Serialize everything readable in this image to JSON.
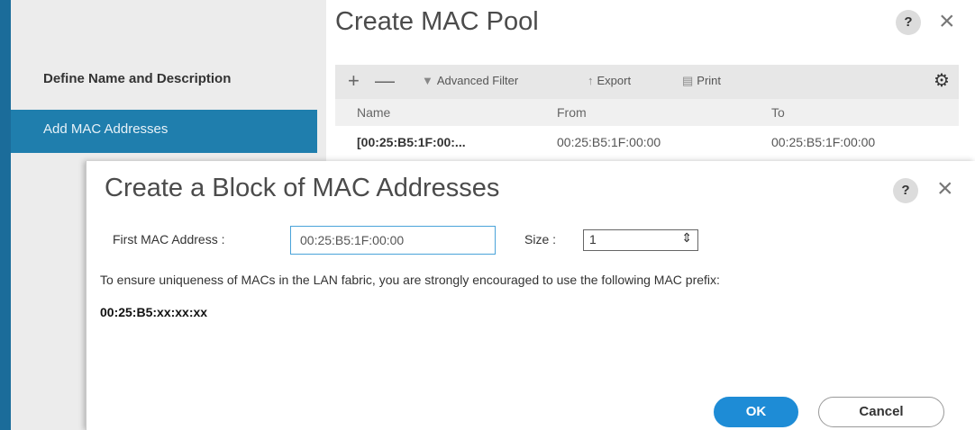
{
  "wizard": {
    "steps": [
      {
        "label": "Define Name and Description"
      },
      {
        "label": "Add MAC Addresses"
      }
    ]
  },
  "outer_dialog": {
    "title": "Create MAC Pool",
    "help_label": "?",
    "close_label": "×",
    "toolbar": {
      "add_label": "+",
      "remove_label": "—",
      "filter_label": "Advanced Filter",
      "export_label": "Export",
      "print_label": "Print",
      "settings_icon": "gear-icon"
    },
    "table": {
      "columns": [
        "Name",
        "From",
        "To"
      ],
      "rows": [
        {
          "name": "[00:25:B5:1F:00:...",
          "from": "00:25:B5:1F:00:00",
          "to": "00:25:B5:1F:00:00"
        }
      ]
    }
  },
  "modal": {
    "title": "Create a Block of MAC Addresses",
    "help_label": "?",
    "close_label": "×",
    "first_mac_label": "First MAC Address :",
    "first_mac_value": "00:25:B5:1F:00:00",
    "size_label": "Size :",
    "size_value": "1",
    "info_text": "To ensure uniqueness of MACs in the LAN fabric, you are strongly encouraged to use the following MAC prefix:",
    "prefix_text": "00:25:B5:xx:xx:xx",
    "ok_label": "OK",
    "cancel_label": "Cancel"
  },
  "colors": {
    "accent": "#1f7ead",
    "primary_button": "#1e8cd6",
    "input_focus_border": "#4aa3d9"
  }
}
